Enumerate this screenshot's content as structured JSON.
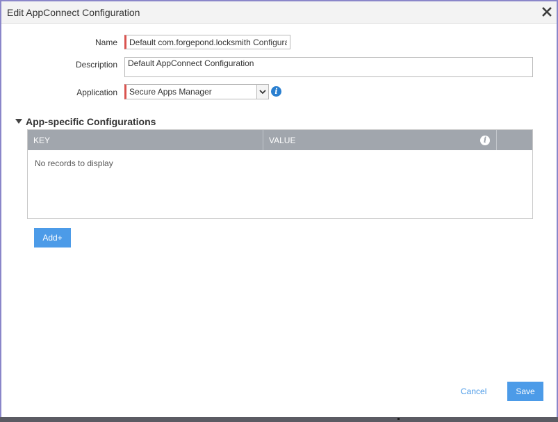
{
  "dialog": {
    "title": "Edit AppConnect Configuration"
  },
  "form": {
    "name_label": "Name",
    "name_value": "Default com.forgepond.locksmith Configura",
    "description_label": "Description",
    "description_value": "Default AppConnect Configuration",
    "application_label": "Application",
    "application_value": "Secure Apps Manager"
  },
  "section": {
    "title": "App-specific Configurations",
    "columns": [
      "KEY",
      "VALUE"
    ],
    "empty_text": "No records to display",
    "add_label": "Add+"
  },
  "footer": {
    "cancel_label": "Cancel",
    "save_label": "Save"
  },
  "colors": {
    "accent": "#4c9be8",
    "required": "#d9534f",
    "grid_header": "#a1a6ad",
    "info": "#2a7fd0"
  },
  "icons": [
    "close-icon",
    "info-icon",
    "chevron-down-icon",
    "triangle-down-icon"
  ]
}
